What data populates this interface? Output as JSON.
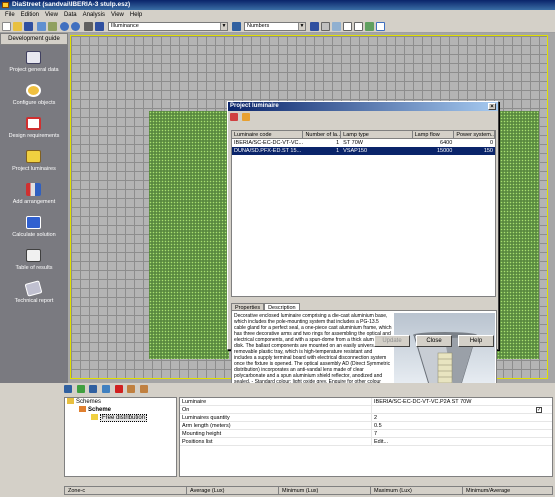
{
  "window": {
    "title": "DiaStreet (sandvai\\IBERIA-3 stulp.esz)"
  },
  "menu": [
    "File",
    "Edition",
    "View",
    "Data",
    "Analysis",
    "View",
    "Help"
  ],
  "toolbar": {
    "combo_luminance": "Illuminance",
    "combo_numbers": "Numbers"
  },
  "sidebar": {
    "header": "Development guide",
    "items": [
      {
        "label": "Project general data",
        "icon": "book-icon",
        "color": "#e8e8f0"
      },
      {
        "label": "Configure objects",
        "icon": "road-object-icon",
        "color": "#f0c040"
      },
      {
        "label": "Design requirements",
        "icon": "requirements-icon",
        "color": "#d03030"
      },
      {
        "label": "Project luminaires",
        "icon": "luminaire-icon",
        "color": "#f0d040"
      },
      {
        "label": "Add arrangement",
        "icon": "arrangement-icon",
        "color": "#e0e0e0"
      },
      {
        "label": "Calculate solution",
        "icon": "calculator-icon",
        "color": "#3060d0"
      },
      {
        "label": "Table of results",
        "icon": "table-icon",
        "color": "#f0f0f0"
      },
      {
        "label": "Technical report",
        "icon": "report-icon",
        "color": "#c0c0d0"
      }
    ]
  },
  "dialog": {
    "title": "Project luminaire",
    "columns": [
      "Luminaire code",
      "Number of la...",
      "Lamp type",
      "Lamp flow",
      "Power system..."
    ],
    "rows": [
      {
        "code": "IBERIA/SC-EC-DC-VT-VC...",
        "number": "1",
        "lamp": "ST 70W",
        "flow": "6400",
        "power": "0",
        "selected": false
      },
      {
        "code": "DUNA/SD.PFX-ED.ST 15...",
        "number": "1",
        "lamp": "VSAP150",
        "flow": "15000",
        "power": "150",
        "selected": true
      }
    ],
    "tabs": [
      "Properties",
      "Description"
    ],
    "description": "Decorative enclosed luminaire comprising a die-cast aluminium base, which includes the pole-mounting system that includes a PG-13.5 cable gland for a perfect seal, a one-piece cast aluminium frame, which has three decorative arms and two rings for assembling the optical and electrical components, and with a spun-dome from a thick aluminium disk. The ballast components are mounted on an easily universal removable plastic tray, which is high-temperature resistant and includes a supply terminal board with electrical disconnection system once the fixture is opened. The optical assembly AD (Direct Symmetric distribution) incorporates an anti-vandal lens made of clear polycarbonate and a spun aluminium shield reflector, anodized and sealed. - Standard colour: light oxide grey. Enquire for other colour options - Maximum wattage: 150W - Protection degree IP66",
    "buttons": {
      "update": "Update",
      "close": "Close",
      "help": "Help"
    }
  },
  "tree": {
    "root": "Schemes",
    "scheme": "Scheme",
    "leaf": "Free distribution"
  },
  "properties": [
    {
      "key": "Luminaire",
      "value": "IBERIA/SC-EC-DC-VT-VC.P2A ST 70W"
    },
    {
      "key": "On",
      "value": "",
      "checkbox": true
    },
    {
      "key": "Luminaires quantity",
      "value": "2"
    },
    {
      "key": "Arm length (meters)",
      "value": "0.5"
    },
    {
      "key": "Mounting height",
      "value": "7"
    },
    {
      "key": "Positions list",
      "value": "Edit..."
    }
  ],
  "zones": {
    "columns": [
      "Zone-c",
      "Average (Lux)",
      "Minimum (Lux)",
      "Maximum (Lux)",
      "Minimum/Average"
    ]
  }
}
